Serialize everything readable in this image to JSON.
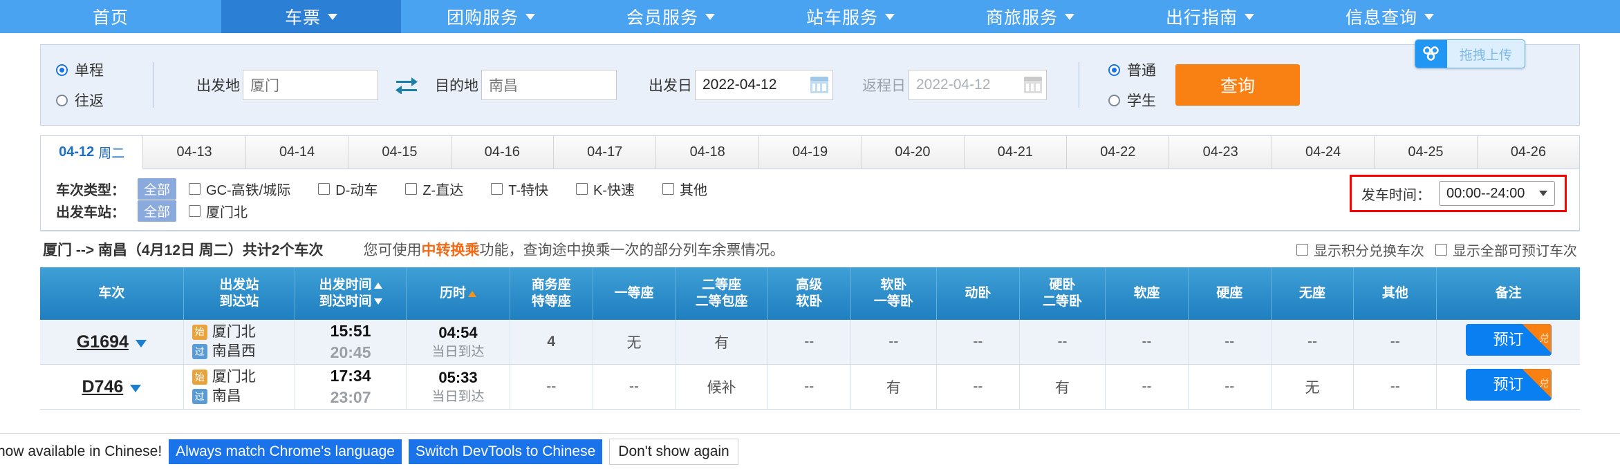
{
  "nav": {
    "items": [
      {
        "label": "首页",
        "has_caret": false,
        "active": false
      },
      {
        "label": "车票",
        "has_caret": true,
        "active": true
      },
      {
        "label": "团购服务",
        "has_caret": true,
        "active": false
      },
      {
        "label": "会员服务",
        "has_caret": true,
        "active": false
      },
      {
        "label": "站车服务",
        "has_caret": true,
        "active": false
      },
      {
        "label": "商旅服务",
        "has_caret": true,
        "active": false
      },
      {
        "label": "出行指南",
        "has_caret": true,
        "active": false
      },
      {
        "label": "信息查询",
        "has_caret": true,
        "active": false
      }
    ],
    "bg_color": "#4aa3f0",
    "active_color": "#2b7fd4"
  },
  "search": {
    "trip_type": {
      "one_way": "单程",
      "round_trip": "往返",
      "selected": "单程"
    },
    "from_label": "出发地",
    "from_value": "厦门",
    "swap_icon": "swap-icon",
    "to_label": "目的地",
    "to_value": "南昌",
    "depart_date_label": "出发日",
    "depart_date_value": "2022-04-12",
    "return_date_label": "返程日",
    "return_date_value": "2022-04-12",
    "passenger_type": {
      "normal": "普通",
      "student": "学生",
      "selected": "普通"
    },
    "query_button": "查询",
    "query_color": "#f98012"
  },
  "netdisk": {
    "label": "拖拽上传",
    "icon": "baidu-netdisk-icon"
  },
  "date_tabs": [
    {
      "date": "04-12",
      "weekday": "周二",
      "active": true
    },
    {
      "date": "04-13",
      "weekday": "",
      "active": false
    },
    {
      "date": "04-14",
      "weekday": "",
      "active": false
    },
    {
      "date": "04-15",
      "weekday": "",
      "active": false
    },
    {
      "date": "04-16",
      "weekday": "",
      "active": false
    },
    {
      "date": "04-17",
      "weekday": "",
      "active": false
    },
    {
      "date": "04-18",
      "weekday": "",
      "active": false
    },
    {
      "date": "04-19",
      "weekday": "",
      "active": false
    },
    {
      "date": "04-20",
      "weekday": "",
      "active": false
    },
    {
      "date": "04-21",
      "weekday": "",
      "active": false
    },
    {
      "date": "04-22",
      "weekday": "",
      "active": false
    },
    {
      "date": "04-23",
      "weekday": "",
      "active": false
    },
    {
      "date": "04-24",
      "weekday": "",
      "active": false
    },
    {
      "date": "04-25",
      "weekday": "",
      "active": false
    },
    {
      "date": "04-26",
      "weekday": "",
      "active": false
    }
  ],
  "filters": {
    "train_type_label": "车次类型：",
    "train_type_all": "全部",
    "train_types": [
      {
        "label": "GC-高铁/城际",
        "checked": false
      },
      {
        "label": "D-动车",
        "checked": false
      },
      {
        "label": "Z-直达",
        "checked": false
      },
      {
        "label": "T-特快",
        "checked": false
      },
      {
        "label": "K-快速",
        "checked": false
      },
      {
        "label": "其他",
        "checked": false
      }
    ],
    "station_label": "出发车站：",
    "station_all": "全部",
    "stations": [
      {
        "label": "厦门北",
        "checked": false
      }
    ],
    "depart_time_label": "发车时间：",
    "depart_time_value": "00:00--24:00",
    "highlight_color": "#ff0000"
  },
  "summary": {
    "route": "厦门 --> 南昌（4月12日 周二）共计2个车次",
    "tip_prefix": "您可使用",
    "tip_link": "中转换乘",
    "tip_suffix": "功能，查询途中换乘一次的部分列车余票情况。",
    "options": [
      {
        "label": "显示积分兑换车次",
        "checked": false
      },
      {
        "label": "显示全部可预订车次",
        "checked": false
      }
    ]
  },
  "table": {
    "headers": [
      {
        "line1": "车次",
        "line2": "",
        "sort": ""
      },
      {
        "line1": "出发站",
        "line2": "到达站",
        "sort": ""
      },
      {
        "line1": "出发时间",
        "line2": "到达时间",
        "sort": "both"
      },
      {
        "line1": "历时",
        "line2": "",
        "sort": "up-orange"
      },
      {
        "line1": "商务座",
        "line2": "特等座",
        "sort": ""
      },
      {
        "line1": "一等座",
        "line2": "",
        "sort": ""
      },
      {
        "line1": "二等座",
        "line2": "二等包座",
        "sort": ""
      },
      {
        "line1": "高级",
        "line2": "软卧",
        "sort": ""
      },
      {
        "line1": "软卧",
        "line2": "一等卧",
        "sort": ""
      },
      {
        "line1": "动卧",
        "line2": "",
        "sort": ""
      },
      {
        "line1": "硬卧",
        "line2": "二等卧",
        "sort": ""
      },
      {
        "line1": "软座",
        "line2": "",
        "sort": ""
      },
      {
        "line1": "硬座",
        "line2": "",
        "sort": ""
      },
      {
        "line1": "无座",
        "line2": "",
        "sort": ""
      },
      {
        "line1": "其他",
        "line2": "",
        "sort": ""
      },
      {
        "line1": "备注",
        "line2": "",
        "sort": ""
      }
    ],
    "rows": [
      {
        "train_no": "G1694",
        "from_badge": "始",
        "from_station": "厦门北",
        "to_badge": "过",
        "to_station": "南昌西",
        "depart_time": "15:51",
        "arrive_time": "20:45",
        "duration": "04:54",
        "duration_note": "当日到达",
        "seats": [
          "4",
          "无",
          "有",
          "--",
          "--",
          "--",
          "--",
          "--",
          "--",
          "--",
          "--"
        ],
        "book_label": "预订",
        "book_corner": "兑"
      },
      {
        "train_no": "D746",
        "from_badge": "始",
        "from_station": "厦门北",
        "to_badge": "过",
        "to_station": "南昌",
        "depart_time": "17:34",
        "arrive_time": "23:07",
        "duration": "05:33",
        "duration_note": "当日到达",
        "seats": [
          "--",
          "--",
          "候补",
          "--",
          "有",
          "--",
          "有",
          "--",
          "--",
          "无",
          "--"
        ],
        "book_label": "预订",
        "book_corner": "兑"
      }
    ]
  },
  "devtools": {
    "message": "now available in Chinese!",
    "always_match": "Always match Chrome's language",
    "switch": "Switch DevTools to Chinese",
    "dont_show": "Don't show again"
  }
}
